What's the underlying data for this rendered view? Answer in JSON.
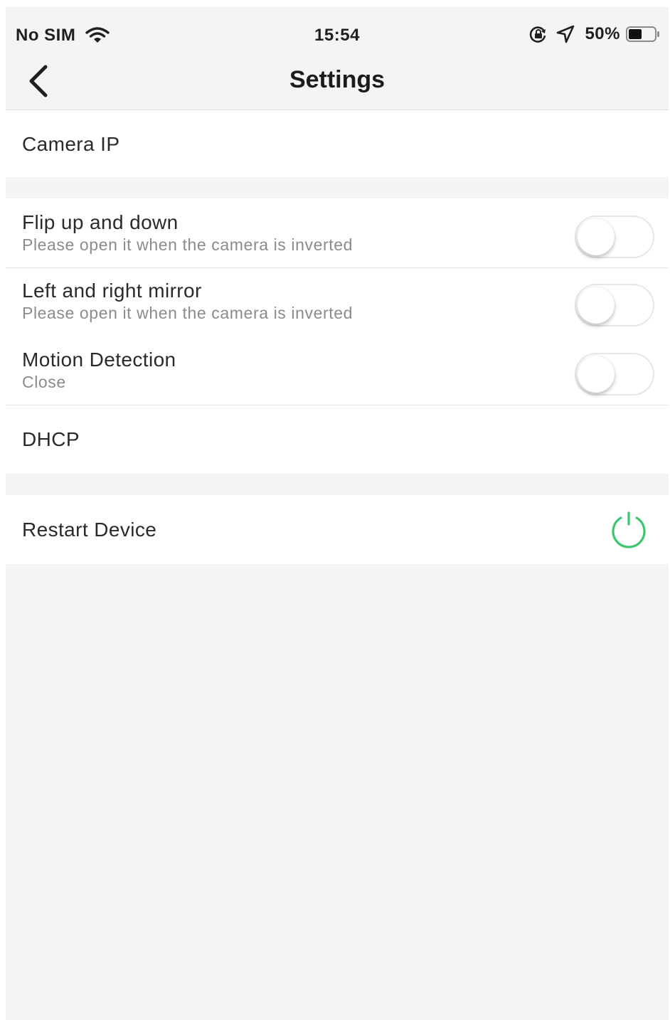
{
  "status_bar": {
    "carrier": "No SIM",
    "time": "15:54",
    "battery_percent": "50%",
    "battery_level": 0.5,
    "icons": [
      "wifi-icon",
      "orientation-lock-icon",
      "location-arrow-icon",
      "battery-icon"
    ]
  },
  "nav": {
    "title": "Settings",
    "back_icon": "chevron-left-icon"
  },
  "rows": {
    "camera_ip": {
      "label": "Camera IP"
    },
    "flip": {
      "label": "Flip up and down",
      "sub": "Please open it when the camera is inverted",
      "toggle_on": false
    },
    "mirror": {
      "label": "Left and right mirror",
      "sub": "Please open it when the camera is inverted",
      "toggle_on": false
    },
    "motion": {
      "label": "Motion Detection",
      "sub": "Close",
      "toggle_on": false
    },
    "dhcp": {
      "label": "DHCP"
    },
    "restart": {
      "label": "Restart Device",
      "icon": "power-icon"
    }
  },
  "colors": {
    "background": "#f4f4f5",
    "row_background": "#ffffff",
    "power_icon": "#3cc66f",
    "subtext": "#8b8b8b"
  }
}
